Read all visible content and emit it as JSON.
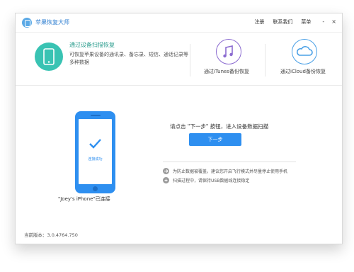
{
  "app": {
    "title": "苹果恢复大师"
  },
  "titlebar": {
    "menu": [
      "注册",
      "联系我们",
      "菜单"
    ],
    "window_controls": [
      "-",
      "×"
    ]
  },
  "modes": [
    {
      "title": "通过设备扫描恢复",
      "description": "可恢复苹果设备的通讯录、备忘录、短信、通话记录等多种数据",
      "icon": "phone-icon",
      "color": "#39c3b3"
    },
    {
      "title": "通过iTunes备份恢复",
      "icon": "music-note-icon",
      "color": "#8b6bd0"
    },
    {
      "title": "通过iCloud备份恢复",
      "icon": "cloud-icon",
      "color": "#4aa0e6"
    }
  ],
  "device": {
    "status": "连接成功",
    "name_label": "\"Joey's iPhone\"已连接"
  },
  "main": {
    "prompt": "请点击 \"下一步\" 按钮，进入设备数据扫描",
    "next_button": "下一步",
    "tips": [
      "为防止数据被覆盖，建议您开启飞行模式并尽量停止使用手机",
      "扫描过程中，请保持USB数据线连接稳定"
    ]
  },
  "footer": {
    "version": "当前版本：3.0.4764.750"
  },
  "colors": {
    "accent": "#2e8ff0",
    "teal": "#39c3b3"
  }
}
